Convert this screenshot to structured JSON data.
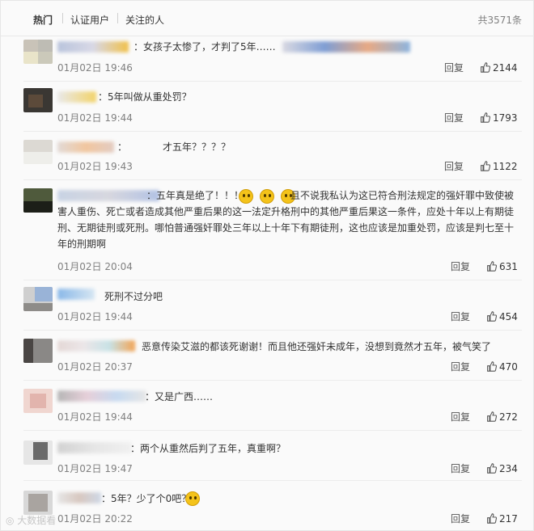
{
  "tabs": [
    {
      "label": "热门",
      "active": true
    },
    {
      "label": "认证用户",
      "active": false
    },
    {
      "label": "关注的人",
      "active": false
    }
  ],
  "total_label": "共3571条",
  "reply_label": "回复",
  "colors": {
    "accent": "#eb7350",
    "date": "#808080",
    "border": "#ececec"
  },
  "comments": [
    {
      "text": "：女孩子太惨了，才判了5年……",
      "date": "01月02日 19:46",
      "likes": "2144"
    },
    {
      "text": "：5年叫做从重处罚？",
      "date": "01月02日 19:44",
      "likes": "1793"
    },
    {
      "text": "：",
      "text2": "才五年？？？？",
      "date": "01月02日 19:43",
      "likes": "1122"
    },
    {
      "text": "：五年真是绝了！！！",
      "text_rest": "且不说我私认为这已符合刑法规定的强奸罪中致使被害人重伤、死亡或者造成其他严重后果的这一法定升格刑中的其他严重后果这一条件，应处十年以上有期徒刑、无期徒刑或死刑。哪怕普通强奸罪处三年以上十年下有期徒刑，这也应该是加重处罚，应该是判七至十年的刑期啊",
      "date": "01月02日 20:04",
      "likes": "631"
    },
    {
      "text": "死刑不过分吧",
      "date": "01月02日 19:44",
      "likes": "454"
    },
    {
      "text": "恶意传染艾滋的都该死谢谢！而且他还强奸未成年，没想到竟然才五年，被气笑了",
      "date": "01月02日 20:37",
      "likes": "470"
    },
    {
      "text": "：又是广西……",
      "date": "01月02日 19:44",
      "likes": "272"
    },
    {
      "text": "：两个从重然后判了五年，真重啊？",
      "date": "01月02日 19:47",
      "likes": "234"
    },
    {
      "text": "：5年？少了个0吧？",
      "date": "01月02日 20:22",
      "likes": "217"
    }
  ],
  "watermark": "大数据看"
}
